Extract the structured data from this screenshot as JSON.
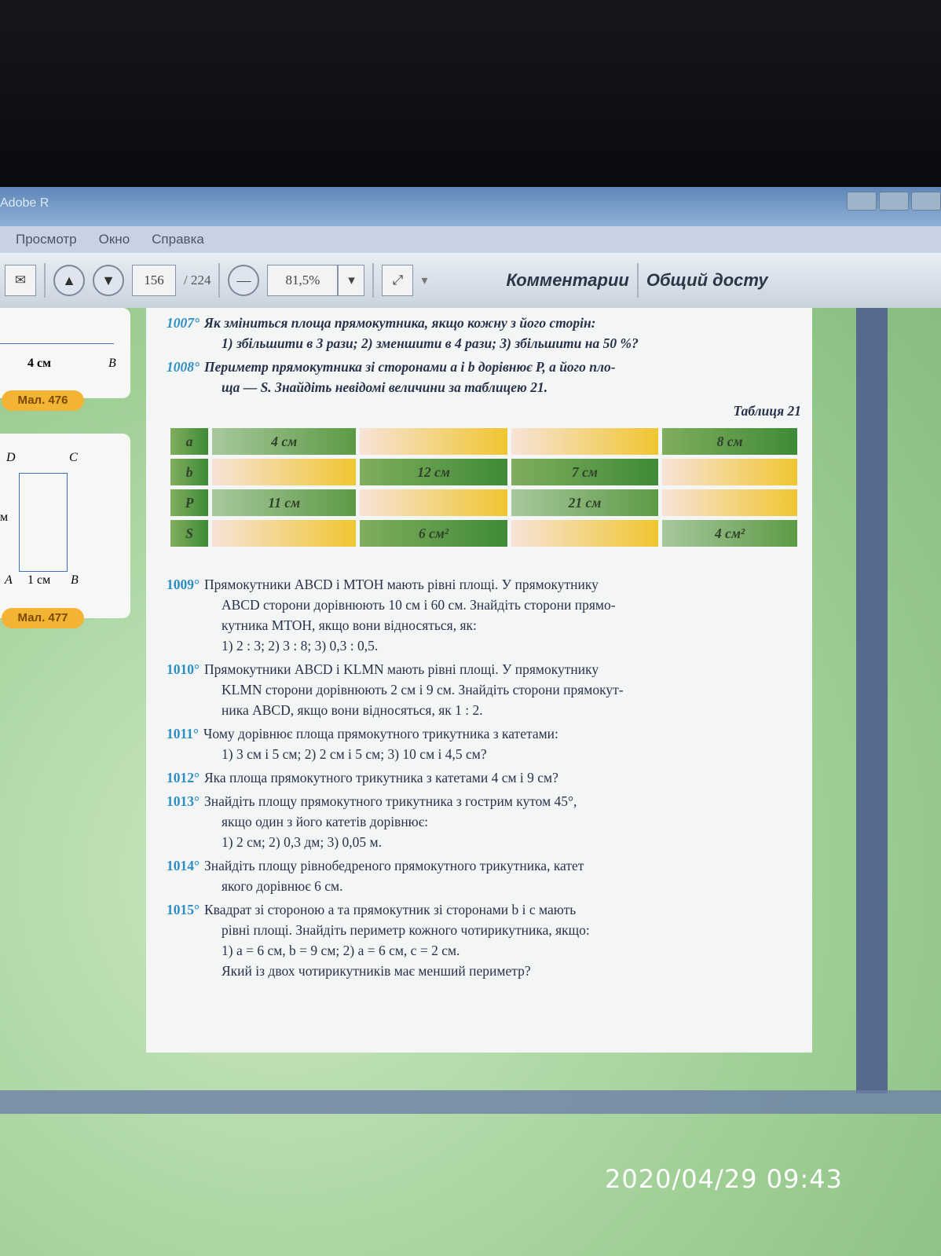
{
  "window": {
    "title": "Adobe R"
  },
  "menu": [
    "Просмотр",
    "Окно",
    "Справка"
  ],
  "toolbar": {
    "page_current": "156",
    "page_total": "/ 224",
    "zoom": "81,5%",
    "comments": "Комментарии",
    "share": "Общий досту"
  },
  "sidebar": {
    "fig476_label": "4 см",
    "fig476_point": "B",
    "fig476_caption": "Мал. 476",
    "fig477_points": [
      "D",
      "C",
      "A",
      "B"
    ],
    "fig477_side": "1 см",
    "fig477_left": "м",
    "fig477_caption": "Мал. 477"
  },
  "problems": [
    {
      "num": "1007°",
      "lines": [
        "Як зміниться площа прямокутника, якщо кожну з його сторін:",
        "1) збільшити в 3 рази; 2) зменшити в 4 рази; 3) збільшити на 50 %?"
      ]
    },
    {
      "num": "1008°",
      "lines": [
        "Периметр прямокутника зі сторонами a і b дорівнює P, а його пло-",
        "ща — S. Знайдіть невідомі величини за таблицею 21."
      ]
    },
    {
      "num": "1009°",
      "lines": [
        "Прямокутники ABCD і MTOH мають рівні площі. У прямокутнику",
        "ABCD сторони дорівнюють 10 см і 60 см. Знайдіть сторони прямо-",
        "кутника MTOH, якщо вони відносяться, як:",
        "1) 2 : 3;   2) 3 : 8;   3) 0,3 : 0,5."
      ]
    },
    {
      "num": "1010°",
      "lines": [
        "Прямокутники ABCD і KLMN мають рівні площі. У прямокутнику",
        "KLMN сторони дорівнюють 2 см і 9 см. Знайдіть сторони прямокут-",
        "ника ABCD, якщо вони відносяться, як 1 : 2."
      ]
    },
    {
      "num": "1011°",
      "lines": [
        "Чому дорівнює площа прямокутного трикутника з катетами:",
        "1) 3 см і 5 см;   2) 2 см і 5 см;   3) 10 см і 4,5 см?"
      ]
    },
    {
      "num": "1012°",
      "lines": [
        "Яка площа прямокутного трикутника з катетами 4 см і 9 см?"
      ]
    },
    {
      "num": "1013°",
      "lines": [
        "Знайдіть площу прямокутного трикутника з гострим кутом 45°,",
        "якщо один з його катетів дорівнює:",
        "1) 2 см;   2) 0,3 дм;   3) 0,05 м."
      ]
    },
    {
      "num": "1014°",
      "lines": [
        "Знайдіть площу рівнобедреного прямокутного трикутника, катет",
        "якого дорівнює 6 см."
      ]
    },
    {
      "num": "1015°",
      "lines": [
        "Квадрат зі стороною a та прямокутник зі сторонами b і c мають",
        "рівні площі. Знайдіть периметр кожного чотирикутника, якщо:",
        "1) a = 6 см, b = 9 см;   2) a = 6 см, c = 2 см.",
        "Який із двох чотирикутників має менший периметр?"
      ]
    }
  ],
  "table": {
    "caption": "Таблиця 21",
    "rows": [
      [
        "a",
        "4 см",
        "",
        "",
        "8 см"
      ],
      [
        "b",
        "",
        "12 см",
        "7 см",
        ""
      ],
      [
        "P",
        "11 см",
        "",
        "21 см",
        ""
      ],
      [
        "S",
        "",
        "6 см²",
        "",
        "4 см²"
      ]
    ]
  },
  "timestamp": "2020/04/29  09:43"
}
